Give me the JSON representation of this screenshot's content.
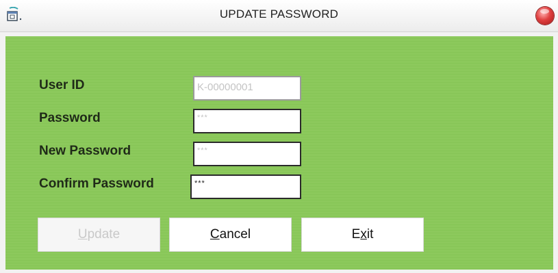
{
  "window": {
    "title": "UPDATE PASSWORD",
    "app_icon": "app-window-icon",
    "close_icon": "close-icon",
    "background_color": "#8cc95c"
  },
  "form": {
    "fields": [
      {
        "label": "User ID",
        "value": "K-00000001",
        "enabled": false
      },
      {
        "label": "Password",
        "value": "***",
        "enabled": true
      },
      {
        "label": "New Password",
        "value": "***",
        "enabled": true
      },
      {
        "label": "Confirm Password",
        "value": "***",
        "enabled": true
      }
    ]
  },
  "buttons": {
    "update": {
      "prefix": "",
      "mnemonic": "U",
      "suffix": "pdate",
      "enabled": false
    },
    "cancel": {
      "prefix": "",
      "mnemonic": "C",
      "suffix": "ancel",
      "enabled": true
    },
    "exit": {
      "prefix": "E",
      "mnemonic": "x",
      "suffix": "it",
      "enabled": true
    }
  }
}
